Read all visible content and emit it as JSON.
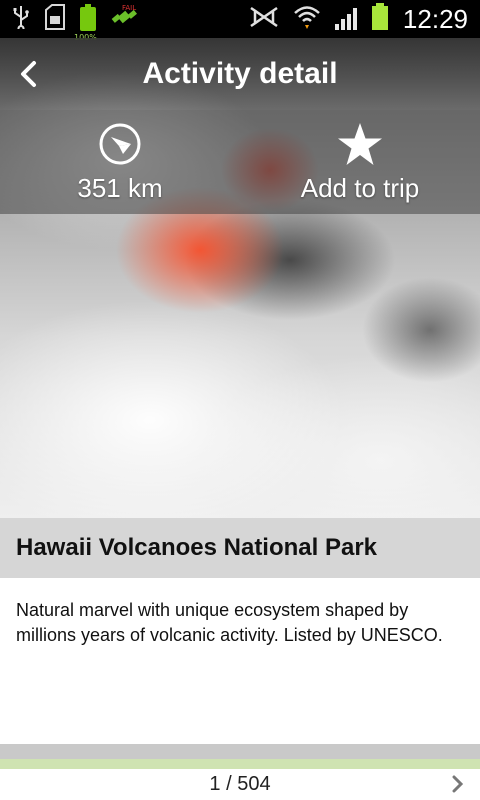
{
  "status_bar": {
    "battery_small_label": "100%",
    "time": "12:29",
    "icons": [
      "usb-icon",
      "sd-card-icon",
      "battery-full-icon",
      "gps-icon",
      "mute-icon",
      "wifi-icon",
      "signal-icon",
      "battery-icon"
    ]
  },
  "header": {
    "title": "Activity detail",
    "back_icon": "chevron-left-icon"
  },
  "actions": {
    "distance_label": "351 km",
    "distance_icon": "compass-icon",
    "add_trip_label": "Add to trip",
    "add_trip_icon": "star-icon"
  },
  "place": {
    "title": "Hawaii Volcanoes National Park",
    "description": "Natural marvel with unique ecosystem shaped by millions years of volcanic activity. Listed by UNESCO."
  },
  "pager": {
    "text": "1 / 504",
    "next_icon": "chevron-right-icon"
  },
  "colors": {
    "status_bar_bg": "#000000",
    "battery_green": "#76c80e",
    "title_band_bg": "#d6d6d6",
    "pager_accent": "#cfe3b2"
  }
}
